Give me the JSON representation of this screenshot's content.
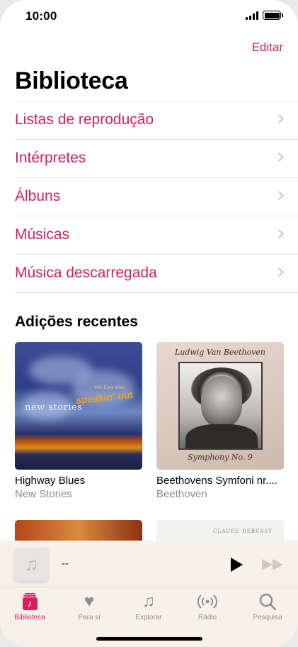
{
  "status_bar": {
    "time": "10:00"
  },
  "header": {
    "edit_label": "Editar",
    "title": "Biblioteca"
  },
  "menu": [
    {
      "label": "Listas de reprodução"
    },
    {
      "label": "Intérpretes"
    },
    {
      "label": "Álbuns"
    },
    {
      "label": "Músicas"
    },
    {
      "label": "Música descarregada"
    }
  ],
  "recent": {
    "title": "Adições recentes",
    "albums": [
      {
        "name": "Highway Blues",
        "artist": "New Stories",
        "cover_text": "new stories",
        "cover_text_2": "speakin' out",
        "cover_small_text": "With Ernie Watts"
      },
      {
        "name": "Beethovens Symfoni nr....",
        "artist": "Beethoven",
        "cover_top": "Ludwig Van Beethoven",
        "cover_bottom": "Symphony No. 9"
      }
    ],
    "peek_text": "CLAUDE DEBUSSY"
  },
  "player": {
    "title": "--"
  },
  "tabs": [
    {
      "label": "Biblioteca",
      "icon": "library-icon",
      "active": true
    },
    {
      "label": "Para si",
      "icon": "heart-icon"
    },
    {
      "label": "Explorar",
      "icon": "music-note-icon"
    },
    {
      "label": "Rádio",
      "icon": "radio-icon"
    },
    {
      "label": "Pesquisa",
      "icon": "search-icon"
    }
  ],
  "colors": {
    "accent": "#d2215b",
    "bar_bg": "#f7f1ea"
  }
}
